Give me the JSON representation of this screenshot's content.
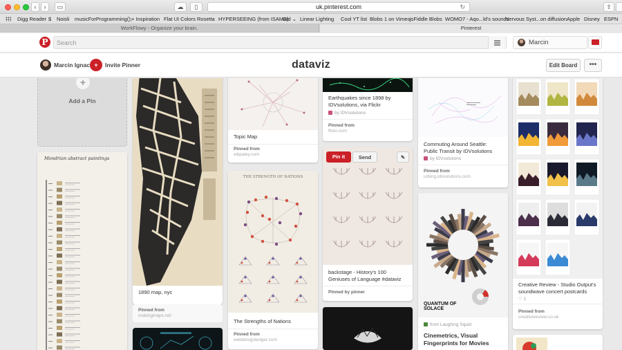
{
  "browser": {
    "url": "uk.pinterest.com",
    "bookmarks": [
      "Digg Reader",
      "$",
      "Noisli",
      "musicForProgramming();",
      "+ Inspiration",
      "Flat UI Colors",
      "Rosetta",
      "HYPERSEEING (from ISAMA)",
      "Old ⌄",
      "Linear Lighting",
      "Cool YT list",
      "Blobs 1 on Vimeo",
      "jsFiddle Blobs",
      "WOMO7 - Aqo...ld's sounds",
      "Nervous Syst...on diffusion",
      "Apple",
      "Disney",
      "ESPN"
    ],
    "tabs": [
      "WorkFlowy - Organize your brain.",
      "Pinterest"
    ]
  },
  "header": {
    "logo": "P",
    "search_placeholder": "Search",
    "user_name": "Marcin"
  },
  "board": {
    "owner": "Marcin Ignac",
    "invite_label": "Invite Pinner",
    "title": "dataviz",
    "edit_label": "Edit Board",
    "more_label": "•••"
  },
  "add_pin": {
    "plus": "+",
    "label": "Add a Pin"
  },
  "pins": {
    "map_1890": {
      "desc": "1890 map, nyc",
      "from_label": "Pinned from",
      "source": "makingmaps.net"
    },
    "topic_map": {
      "desc": "Topic Map",
      "from_label": "Pinned from",
      "source": "wbpaley.com"
    },
    "strengths": {
      "image_title": "THE STRENGTH OF NATIONS",
      "desc": "The Strengths of Nations",
      "from_label": "Pinned from",
      "source": "webdesignledger.com"
    },
    "mondrian": {
      "image_title": "Mondrian abstract paintings"
    },
    "earthquakes": {
      "desc": "Earthquakes since 1898 by IDVsolutions, via Flickr",
      "from_label": "Pinned from",
      "source": "flickr.com"
    },
    "backstage": {
      "pin_it": "Pin it",
      "send": "Send",
      "desc": "backstage - History's 100 Geniuses of Language #dataviz",
      "pinned_by": "Pinned by pinner"
    },
    "seattle": {
      "desc": "Commuting Around Seattle: Public Transit by IDVsolutions",
      "via": "by IDVsolutions",
      "from_label": "Pinned from",
      "source": "urbing.idvsolutions.com"
    },
    "quantum": {
      "image_title": "QUANTUM OF SOLACE",
      "via": "from Laughing Squid",
      "desc": "Cinemetrics, Visual Fingerprints for Movies"
    },
    "postcards": {
      "desc": "Creative Review - Studio Output's soundwave concert postcards",
      "likes": "1",
      "from_label": "Pinned from",
      "source": "creativereview.co.uk"
    }
  },
  "colors": {
    "pinterest_red": "#cb2027",
    "background": "#e9e9e9"
  }
}
